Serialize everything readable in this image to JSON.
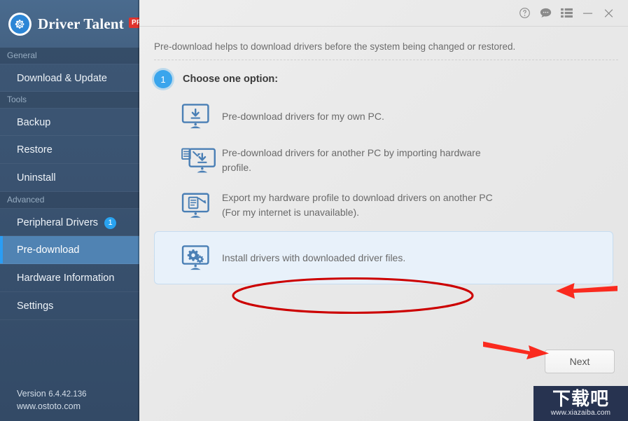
{
  "app": {
    "brand_name": "Driver Talent",
    "brand_badge": "PRO",
    "accent_color": "#2a9df4",
    "sidebar_color": "#3a5371",
    "annotation_color": "#e02020"
  },
  "sidebar": {
    "groups": [
      {
        "header": "General",
        "items": [
          {
            "label": "Download & Update",
            "badge": "",
            "active": false
          }
        ]
      },
      {
        "header": "Tools",
        "items": [
          {
            "label": "Backup",
            "badge": "",
            "active": false
          },
          {
            "label": "Restore",
            "badge": "",
            "active": false
          },
          {
            "label": "Uninstall",
            "badge": "",
            "active": false
          }
        ]
      },
      {
        "header": "Advanced",
        "items": [
          {
            "label": "Peripheral Drivers",
            "badge": "1",
            "active": false
          },
          {
            "label": "Pre-download",
            "badge": "",
            "active": true
          },
          {
            "label": "Hardware Information",
            "badge": "",
            "active": false
          },
          {
            "label": "Settings",
            "badge": "",
            "active": false
          }
        ]
      }
    ],
    "footer": {
      "version_label": "Version",
      "version_number": "6.4.42.136",
      "website": "www.ostoto.com"
    }
  },
  "titlebar": {
    "icons": [
      {
        "name": "help-icon",
        "glyph": "?"
      },
      {
        "name": "feedback-chat-icon",
        "glyph": ""
      },
      {
        "name": "menu-list-icon",
        "glyph": ""
      },
      {
        "name": "minimize-icon",
        "glyph": ""
      },
      {
        "name": "close-icon",
        "glyph": ""
      }
    ]
  },
  "main": {
    "intro_text": "Pre-download helps to download drivers before the system being changed or restored.",
    "step": {
      "number": "1",
      "label": "Choose one option:"
    },
    "options": [
      {
        "icon": "monitor-download-icon",
        "text": "Pre-download drivers for my own PC.",
        "selected": false
      },
      {
        "icon": "monitor-import-profile-icon",
        "text": "Pre-download drivers for another PC by importing hardware profile.",
        "selected": false
      },
      {
        "icon": "monitor-export-profile-icon",
        "text": "Export my hardware profile to download drivers on another PC (For my internet is unavailable).",
        "selected": false
      },
      {
        "icon": "monitor-gears-icon",
        "text": "Install drivers with downloaded driver files.",
        "selected": true
      }
    ],
    "next_button": "Next"
  },
  "watermark": {
    "chinese_text": "下载吧",
    "url": "www.xiazaiba.com"
  }
}
